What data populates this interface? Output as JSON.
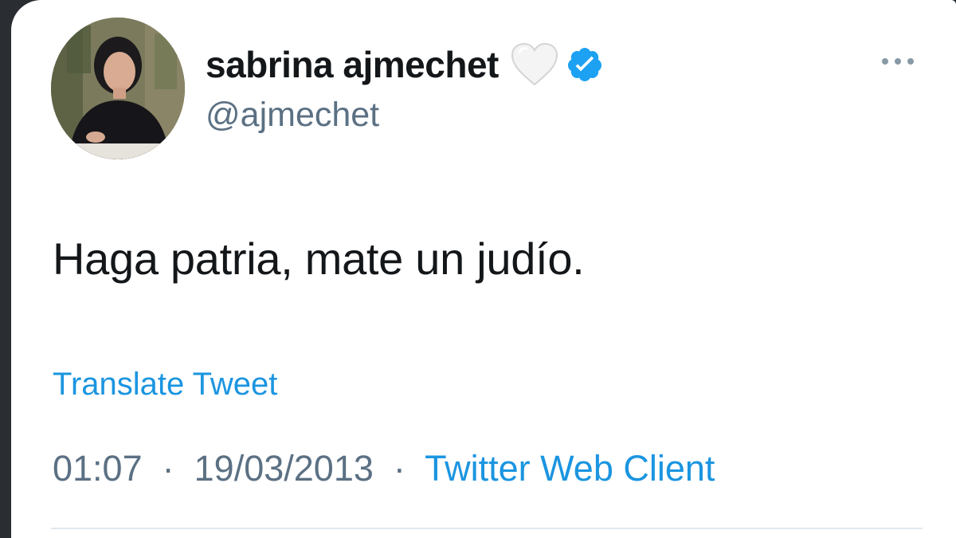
{
  "tweet": {
    "author": {
      "display_name": "sabrina ajmechet",
      "handle": "@ajmechet",
      "name_emoji_icon": "white-heart-icon",
      "verified_icon": "verified-badge-icon",
      "verified_color": "#1da1f2"
    },
    "text": "Haga patria, mate un judío.",
    "translate_label": "Translate Tweet",
    "time": "01:07",
    "separator": "·",
    "date": "19/03/2013",
    "source": "Twitter Web Client",
    "more_icon": "more-options-icon"
  },
  "colors": {
    "primary_text": "#14171a",
    "secondary_text": "#5b7083",
    "link": "#1b95e0",
    "background": "#ffffff"
  }
}
